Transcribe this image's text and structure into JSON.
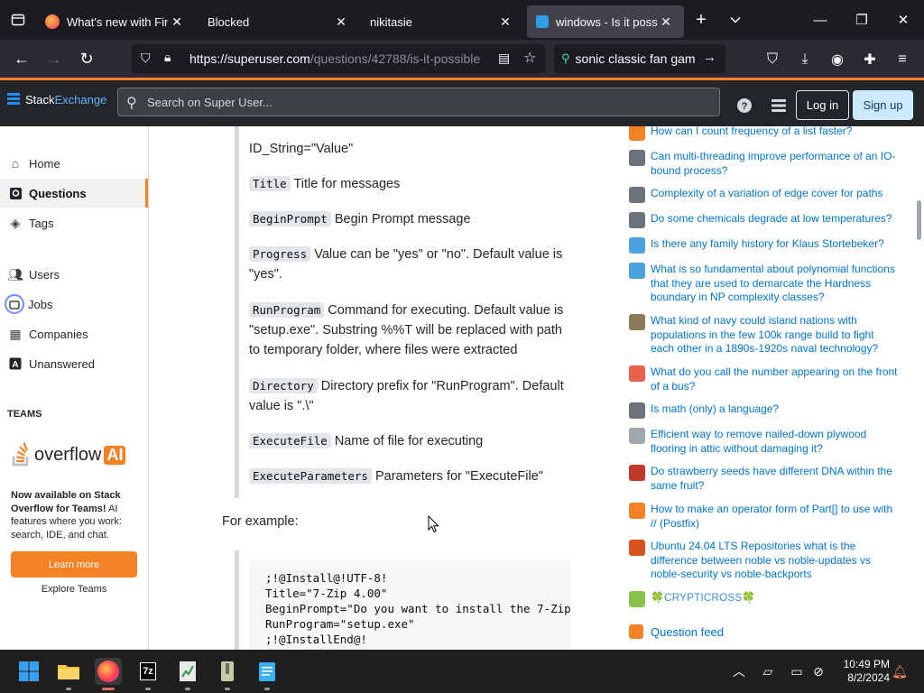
{
  "browser": {
    "tabs": [
      {
        "title": "What's new with Firefox",
        "active": false
      },
      {
        "title": "Blocked",
        "active": false
      },
      {
        "title": "nikitasie",
        "active": false
      },
      {
        "title": "windows - Is it possible",
        "active": true
      }
    ],
    "url_base": "https://superuser.com",
    "url_path": "/questions/42788/is-it-possible",
    "search_text": "sonic classic fan gam"
  },
  "site": {
    "logo_a": "Stack",
    "logo_b": "Exchange",
    "search_placeholder": "Search on Super User...",
    "login": "Log in",
    "signup": "Sign up"
  },
  "nav": {
    "home": "Home",
    "questions": "Questions",
    "tags": "Tags",
    "users": "Users",
    "jobs": "Jobs",
    "companies": "Companies",
    "unanswered": "Unanswered",
    "teams_heading": "TEAMS",
    "oai_word": "overflow",
    "oai_ai": "AI",
    "teams_desc_bold": "Now available on Stack Overflow for Teams!",
    "teams_desc_rest": " AI features where you work: search, IDE, and chat.",
    "learn_more": "Learn more",
    "explore_teams": "Explore Teams"
  },
  "content": {
    "id_string": "ID_String=\"Value\"",
    "params": [
      {
        "key": "Title",
        "desc": "Title for messages"
      },
      {
        "key": "BeginPrompt",
        "desc": "Begin Prompt message"
      },
      {
        "key": "Progress",
        "desc": "Value can be \"yes\" or \"no\". Default value is \"yes\"."
      },
      {
        "key": "RunProgram",
        "desc": "Command for executing. Default value is \"setup.exe\". Substring %%T will be replaced with path to temporary folder, where files were extracted"
      },
      {
        "key": "Directory",
        "desc": "Directory prefix for \"RunProgram\". Default value is \".\\\""
      },
      {
        "key": "ExecuteFile",
        "desc": "Name of file for executing"
      },
      {
        "key": "ExecuteParameters",
        "desc": "Parameters for \"ExecuteFile\""
      }
    ],
    "example_label": "For example:",
    "code_lines": [
      ";!@Install@!UTF-8!",
      "Title=\"7-Zip 4.00\"",
      "BeginPrompt=\"Do you want to install the 7-Zip",
      "RunProgram=\"setup.exe\"",
      ";!@InstallEnd@!"
    ]
  },
  "hot_questions": [
    {
      "title": "How can I count frequency of a list faster?",
      "color": "#f48225"
    },
    {
      "title": "Can multi-threading improve performance of an IO-bound process?",
      "color": "#6a737c"
    },
    {
      "title": "Complexity of a variation of edge cover for paths",
      "color": "#6a737c"
    },
    {
      "title": "Do some chemicals degrade at low temperatures?",
      "color": "#6a737c"
    },
    {
      "title": "Is there any family history for Klaus Stortebeker?",
      "color": "#4aa3df"
    },
    {
      "title": "What is so fundamental about polynomial functions that they are used to demarcate the Hardness boundary in NP complexity classes?",
      "color": "#4aa3df"
    },
    {
      "title": "What kind of navy could island nations with populations in the few 100k range build to fight each other in a 1890s-1920s naval technology?",
      "color": "#8a7b5a"
    },
    {
      "title": "What do you call the number appearing on the front of a bus?",
      "color": "#e8624a"
    },
    {
      "title": "Is math (only) a language?",
      "color": "#6a737c"
    },
    {
      "title": "Efficient way to remove nailed-down plywood flooring in attic without damaging it?",
      "color": "#9fa6ad"
    },
    {
      "title": "Do strawberry seeds have different DNA within the same fruit?",
      "color": "#c0392b"
    },
    {
      "title": "How to make an operator form of Part[] to use with // (Postfix)",
      "color": "#f48225"
    },
    {
      "title": "Ubuntu 24.04 LTS Repositories what is the difference between noble vs noble-updates vs noble-security vs noble-backports",
      "color": "#d9531e"
    },
    {
      "title": "🍀CRYPTICROSS🍀",
      "color": "#8bc34a"
    }
  ],
  "question_feed": "Question feed",
  "taskbar": {
    "time": "10:49 PM",
    "date": "8/2/2024"
  }
}
